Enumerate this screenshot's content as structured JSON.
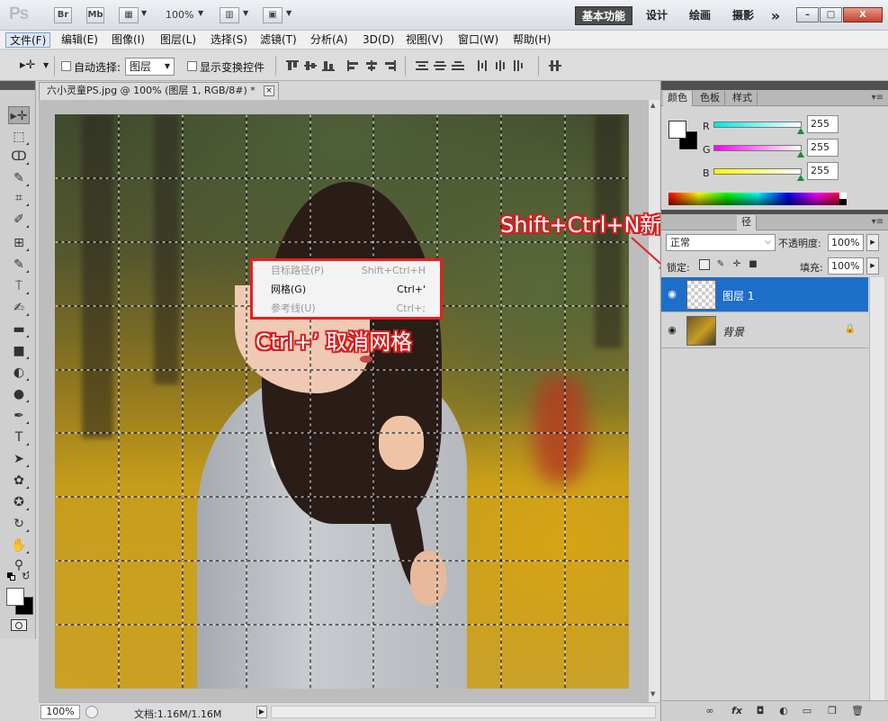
{
  "titlebar": {
    "logo": "Ps",
    "bridge_label": "Br",
    "minibridge_label": "Mb",
    "zoom": "100%",
    "workspaces": [
      "基本功能",
      "设计",
      "绘画",
      "摄影"
    ],
    "more": "»",
    "window_controls": {
      "minimize": "–",
      "restore": "□",
      "close": "X"
    }
  },
  "menubar": {
    "items": [
      "文件(F)",
      "编辑(E)",
      "图像(I)",
      "图层(L)",
      "选择(S)",
      "滤镜(T)",
      "分析(A)",
      "3D(D)",
      "视图(V)",
      "窗口(W)",
      "帮助(H)"
    ],
    "active_index": 0
  },
  "options": {
    "auto_select_label": "自动选择:",
    "auto_select_value": "图层",
    "show_transform_label": "显示变换控件"
  },
  "tools": {
    "icons": [
      "move-tool-icon",
      "marquee-tool-icon",
      "lasso-tool-icon",
      "quick-select-tool-icon",
      "crop-tool-icon",
      "eyedropper-tool-icon",
      "healing-brush-tool-icon",
      "brush-tool-icon",
      "clone-stamp-tool-icon",
      "history-brush-tool-icon",
      "eraser-tool-icon",
      "gradient-tool-icon",
      "blur-tool-icon",
      "dodge-tool-icon",
      "pen-tool-icon",
      "type-tool-icon",
      "path-select-tool-icon",
      "shape-tool-icon",
      "3d-rotate-tool-icon",
      "3d-orbit-tool-icon",
      "hand-tool-icon",
      "zoom-tool-icon"
    ],
    "glyphs": [
      "▸✛",
      "⬚",
      "ↀ",
      "✎",
      "⌗",
      "✐",
      "⊞",
      "✎",
      "⍑",
      "✍",
      "▬",
      "■",
      "◐",
      "●",
      "✒",
      "T",
      "➤",
      "✿",
      "✪",
      "↻",
      "✋",
      "⚲"
    ]
  },
  "document": {
    "tab_title": "六小灵童PS.jpg @ 100% (图层 1, RGB/8#) *",
    "close": "×"
  },
  "context_menu": {
    "items": [
      {
        "label": "目标路径(P)",
        "shortcut": "Shift+Ctrl+H",
        "enabled": false
      },
      {
        "label": "网格(G)",
        "shortcut": "Ctrl+'",
        "enabled": true
      },
      {
        "label": "参考线(U)",
        "shortcut": "Ctrl+;",
        "enabled": false
      }
    ]
  },
  "annotations": {
    "cancel_grid": "Ctrl+’ 取消网格",
    "new_layer": "Shift+Ctrl+N新建图层"
  },
  "statusbar": {
    "zoom": "100%",
    "doc_info": "文档:1.16M/1.16M"
  },
  "color_panel": {
    "tabs": [
      "颜色",
      "色板",
      "样式"
    ],
    "r_label": "R",
    "g_label": "G",
    "b_label": "B",
    "r_value": "255",
    "g_value": "255",
    "b_value": "255",
    "colors": {
      "r": "#00e5e5",
      "g": "#ff00ff",
      "b": "#ffff00"
    }
  },
  "layers_panel": {
    "tab_visible": "径",
    "blend_mode": "正常",
    "opacity_label": "不透明度:",
    "opacity_value": "100%",
    "lock_label": "锁定:",
    "fill_label": "填充:",
    "fill_value": "100%",
    "layers": [
      {
        "name": "图层 1",
        "selected": true,
        "locked": false
      },
      {
        "name": "背景",
        "selected": false,
        "locked": true
      }
    ],
    "bottom_icons": [
      "link-layers-icon",
      "fx-icon",
      "mask-icon",
      "adjustment-icon",
      "group-icon",
      "new-layer-icon",
      "trash-icon"
    ]
  },
  "accent": {
    "red": "#e8201e",
    "selection_blue": "#1e6fc9"
  }
}
